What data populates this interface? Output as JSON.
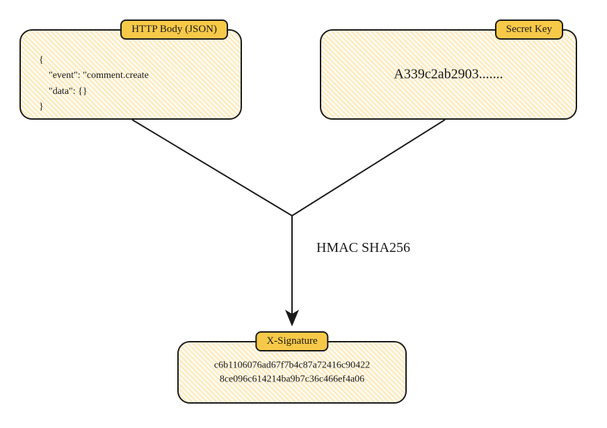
{
  "http_body": {
    "label": "HTTP Body (JSON)",
    "content": "{\n    \"event\": \"comment.create\n    \"data\": {}\n}"
  },
  "secret_key": {
    "label": "Secret Key",
    "content": "A339c2ab2903......."
  },
  "algorithm": "HMAC SHA256",
  "signature": {
    "label": "X-Signature",
    "line1": "c6b1106076ad67f7b4c87a72416c90422",
    "line2": "8ce096c614214ba9b7c36c466ef4a06"
  }
}
